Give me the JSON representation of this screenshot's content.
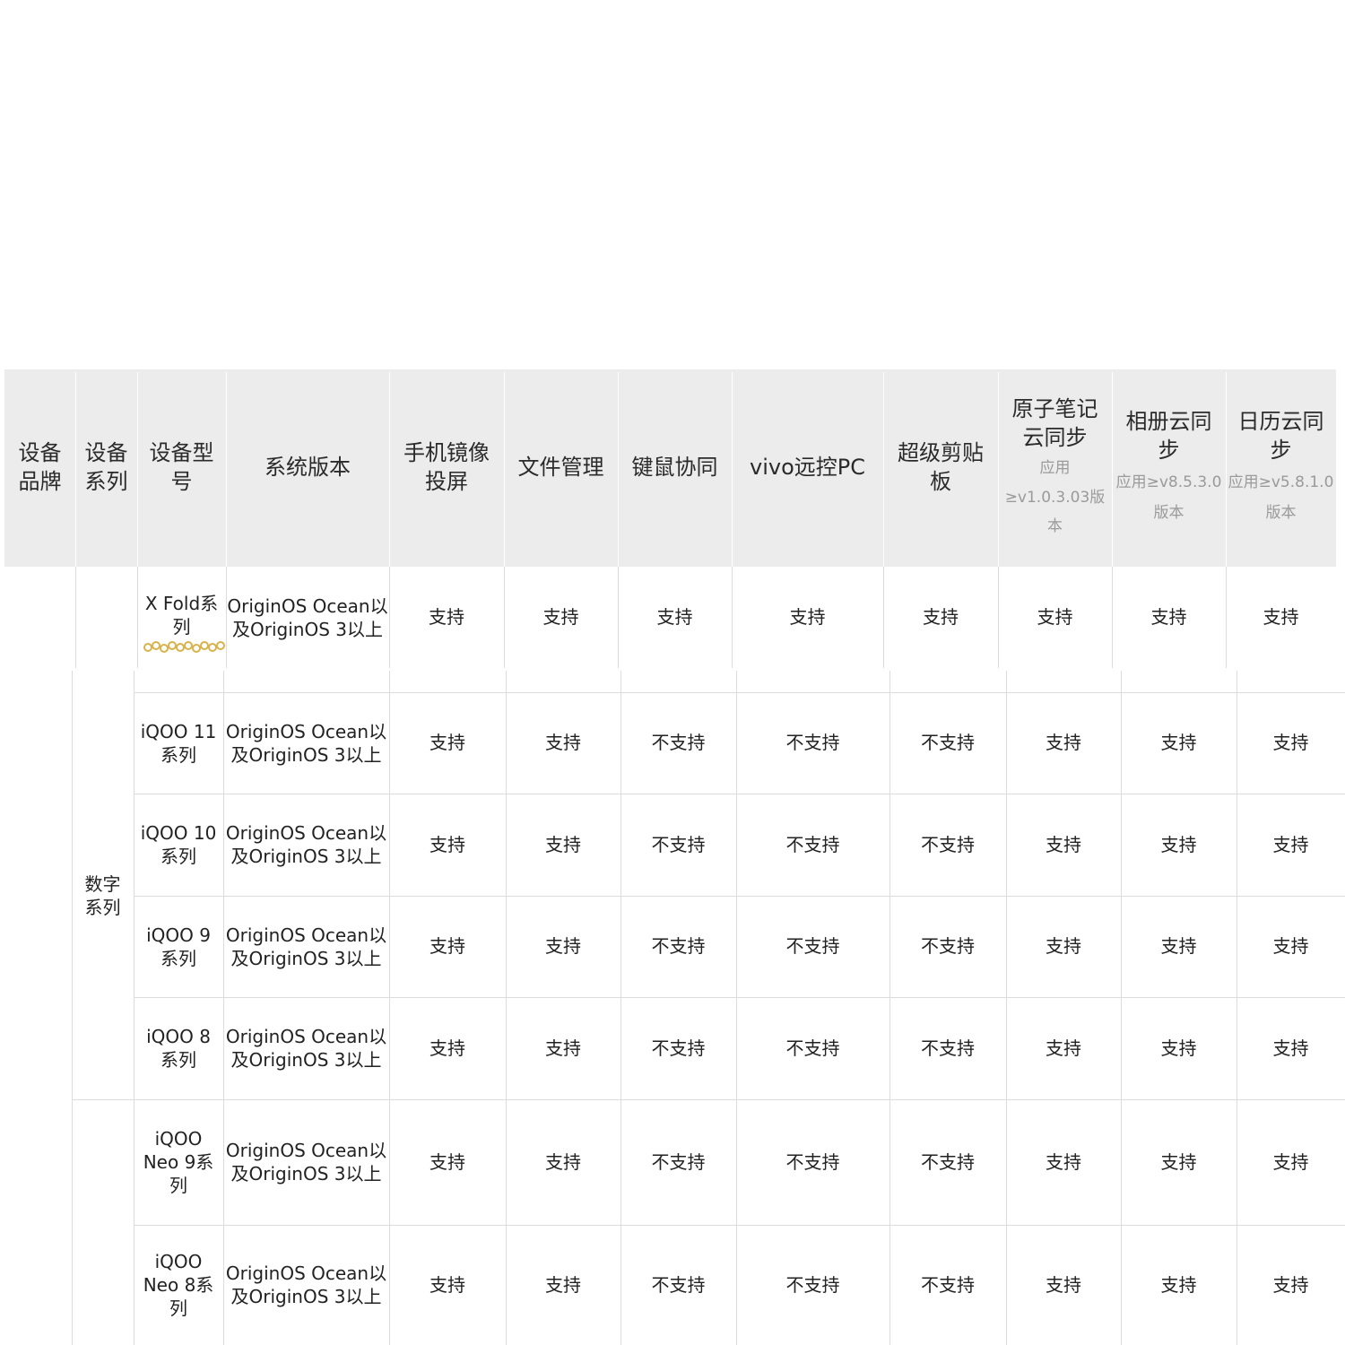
{
  "header": {
    "brand": "设备\n品牌",
    "series": "设备\n系列",
    "model": "设备型\n号",
    "os": "系统版本",
    "mirror": "手机镜像\n投屏",
    "files": "文件管理",
    "kbm": "键鼠协同",
    "remote": "vivo远控PC",
    "clipboard": "超级剪贴\n板",
    "notes": "原子笔记\n云同步",
    "notes_sub": "应用\n≥v1.0.3.03版\n本",
    "album": "相册云同\n步",
    "album_sub": "应用≥v8.5.3.0\n版本",
    "calendar": "日历云同\n步",
    "calendar_sub": "应用≥v5.8.1.0\n版本"
  },
  "group_label": "数字\n系列",
  "rows": [
    {
      "model": "X Fold系\n列",
      "os": "OriginOS Ocean以\n及OriginOS 3以上",
      "values": [
        "支持",
        "支持",
        "支持",
        "支持",
        "支持",
        "支持",
        "支持",
        "支持"
      ]
    },
    {
      "model": "iQOO 11\n系列",
      "os": "OriginOS Ocean以\n及OriginOS 3以上",
      "values": [
        "支持",
        "支持",
        "不支持",
        "不支持",
        "不支持",
        "支持",
        "支持",
        "支持"
      ]
    },
    {
      "model": "iQOO 10\n系列",
      "os": "OriginOS Ocean以\n及OriginOS 3以上",
      "values": [
        "支持",
        "支持",
        "不支持",
        "不支持",
        "不支持",
        "支持",
        "支持",
        "支持"
      ]
    },
    {
      "model": "iQOO 9\n系列",
      "os": "OriginOS Ocean以\n及OriginOS 3以上",
      "values": [
        "支持",
        "支持",
        "不支持",
        "不支持",
        "不支持",
        "支持",
        "支持",
        "支持"
      ]
    },
    {
      "model": "iQOO 8\n系列",
      "os": "OriginOS Ocean以\n及OriginOS 3以上",
      "values": [
        "支持",
        "支持",
        "不支持",
        "不支持",
        "不支持",
        "支持",
        "支持",
        "支持"
      ]
    },
    {
      "model": "iQOO\nNeo 9系\n列",
      "os": "OriginOS Ocean以\n及OriginOS 3以上",
      "values": [
        "支持",
        "支持",
        "不支持",
        "不支持",
        "不支持",
        "支持",
        "支持",
        "支持"
      ]
    },
    {
      "model": "iQOO\nNeo 8系\n列",
      "os": "OriginOS Ocean以\n及OriginOS 3以上",
      "values": [
        "支持",
        "支持",
        "不支持",
        "不支持",
        "不支持",
        "支持",
        "支持",
        "支持"
      ]
    }
  ]
}
